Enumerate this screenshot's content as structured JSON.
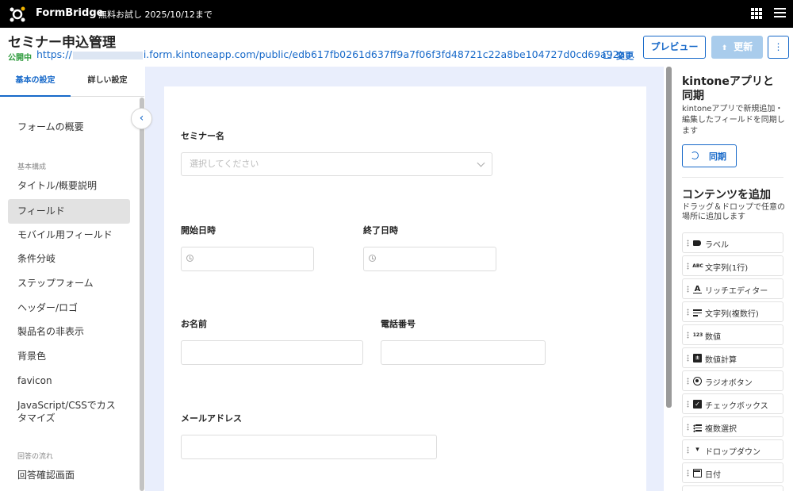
{
  "topbar": {
    "brand": "FormBridge",
    "trial_text": "無料お試し 2025/10/12まで"
  },
  "header": {
    "title": "セミナー申込管理",
    "status": "公開中",
    "url_prefix": "https://",
    "url_suffix": "i.form.kintoneapp.com/public/edb617fb0261d637ff9a7f06f3fd48721c22a8be104727d0cd69a92a…",
    "change_label": "変更",
    "preview_label": "プレビュー",
    "update_label": "更新",
    "more_label": "⋮"
  },
  "left": {
    "tabs": [
      {
        "label": "基本の設定"
      },
      {
        "label": "詳しい設定"
      }
    ],
    "collapse_glyph": "‹",
    "overview": "フォームの概要",
    "section_basic": "基本構成",
    "items": [
      {
        "label": "タイトル/概要説明"
      },
      {
        "label": "フィールド"
      },
      {
        "label": "モバイル用フィールド"
      },
      {
        "label": "条件分岐"
      },
      {
        "label": "ステップフォーム"
      },
      {
        "label": "ヘッダー/ロゴ"
      },
      {
        "label": "製品名の非表示"
      },
      {
        "label": "背景色"
      },
      {
        "label": "favicon"
      },
      {
        "label": "JavaScript/CSSでカスタマイズ"
      }
    ],
    "section_flow": "回答の流れ",
    "flow_items": [
      {
        "label": "回答確認画面"
      }
    ]
  },
  "form": {
    "seminar_label": "セミナー名",
    "seminar_placeholder": "選択してください",
    "start_label": "開始日時",
    "end_label": "終了日時",
    "name_label": "お名前",
    "phone_label": "電話番号",
    "email_label": "メールアドレス"
  },
  "right": {
    "sync_title": "kintoneアプリと同期",
    "sync_desc": "kintoneアプリで新規追加・編集したフィールドを同期します",
    "sync_button": "同期",
    "add_title": "コンテンツを追加",
    "add_desc": "ドラッグ＆ドロップで任意の場所に追加します",
    "components": [
      {
        "label": "ラベル",
        "icon": "label-icon"
      },
      {
        "label": "文字列(1行)",
        "icon": "text-single-icon",
        "glyph": "ABC"
      },
      {
        "label": "リッチエディター",
        "icon": "rich-editor-icon",
        "glyph": "A"
      },
      {
        "label": "文字列(複数行)",
        "icon": "text-multi-icon"
      },
      {
        "label": "数値",
        "icon": "number-icon",
        "glyph": "123"
      },
      {
        "label": "数値計算",
        "icon": "calc-icon",
        "glyph": "±"
      },
      {
        "label": "ラジオボタン",
        "icon": "radio-icon"
      },
      {
        "label": "チェックボックス",
        "icon": "checkbox-icon",
        "glyph": "✓"
      },
      {
        "label": "複数選択",
        "icon": "multi-select-icon"
      },
      {
        "label": "ドロップダウン",
        "icon": "dropdown-icon",
        "glyph": "▾"
      },
      {
        "label": "日付",
        "icon": "calendar-icon"
      }
    ]
  },
  "colors": {
    "accent": "#1769c9",
    "published": "#2e9b3d",
    "canvas_bg": "#e9eefc"
  }
}
